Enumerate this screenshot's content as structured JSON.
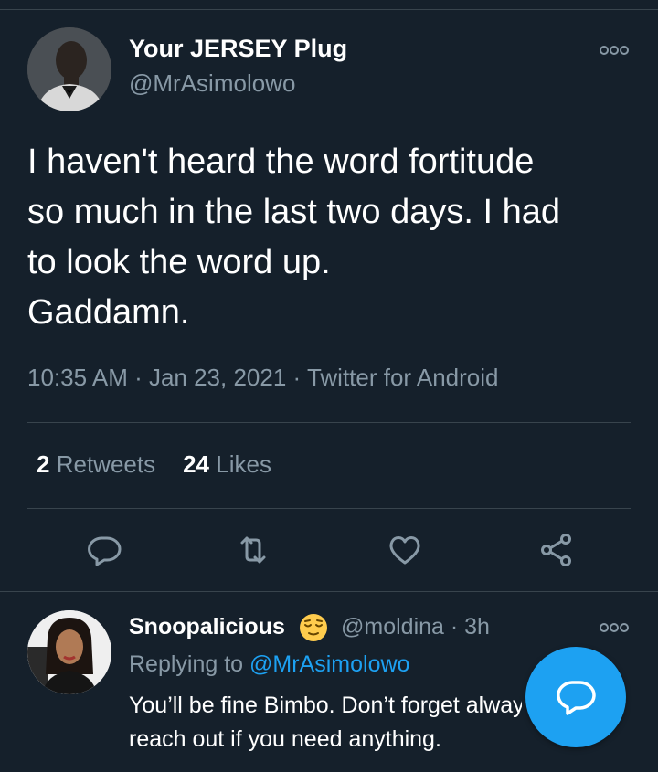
{
  "tweet": {
    "display_name": "Your JERSEY Plug",
    "handle": "@MrAsimolowo",
    "text_lines": [
      "I haven't heard the word fortitude",
      "so much in the last two days. I had",
      "to look the word up.",
      "Gaddamn."
    ],
    "meta": "10:35 AM · Jan 23, 2021 · Twitter for Android",
    "retweet_count": "2",
    "retweet_label": "Retweets",
    "like_count": "24",
    "like_label": "Likes",
    "more_icon": "more-options-icon"
  },
  "actions": [
    "reply-icon",
    "retweet-icon",
    "like-icon",
    "share-icon"
  ],
  "reply": {
    "display_name": "Snoopalicious",
    "emoji": "relieved-face-emoji",
    "handle_time": "@moldina · 3h",
    "replying_prefix": "Replying to ",
    "replying_to": "@MrAsimolowo",
    "text_lines": [
      "You’ll be fine Bimbo. Don’t forget always",
      "reach out if you need anything."
    ]
  },
  "fab": {
    "icon": "compose-reply-icon"
  },
  "colors": {
    "background": "#15202b",
    "divider": "#38444d",
    "secondary_text": "#8899a6",
    "accent": "#1da1f2",
    "primary_text": "#ffffff"
  }
}
